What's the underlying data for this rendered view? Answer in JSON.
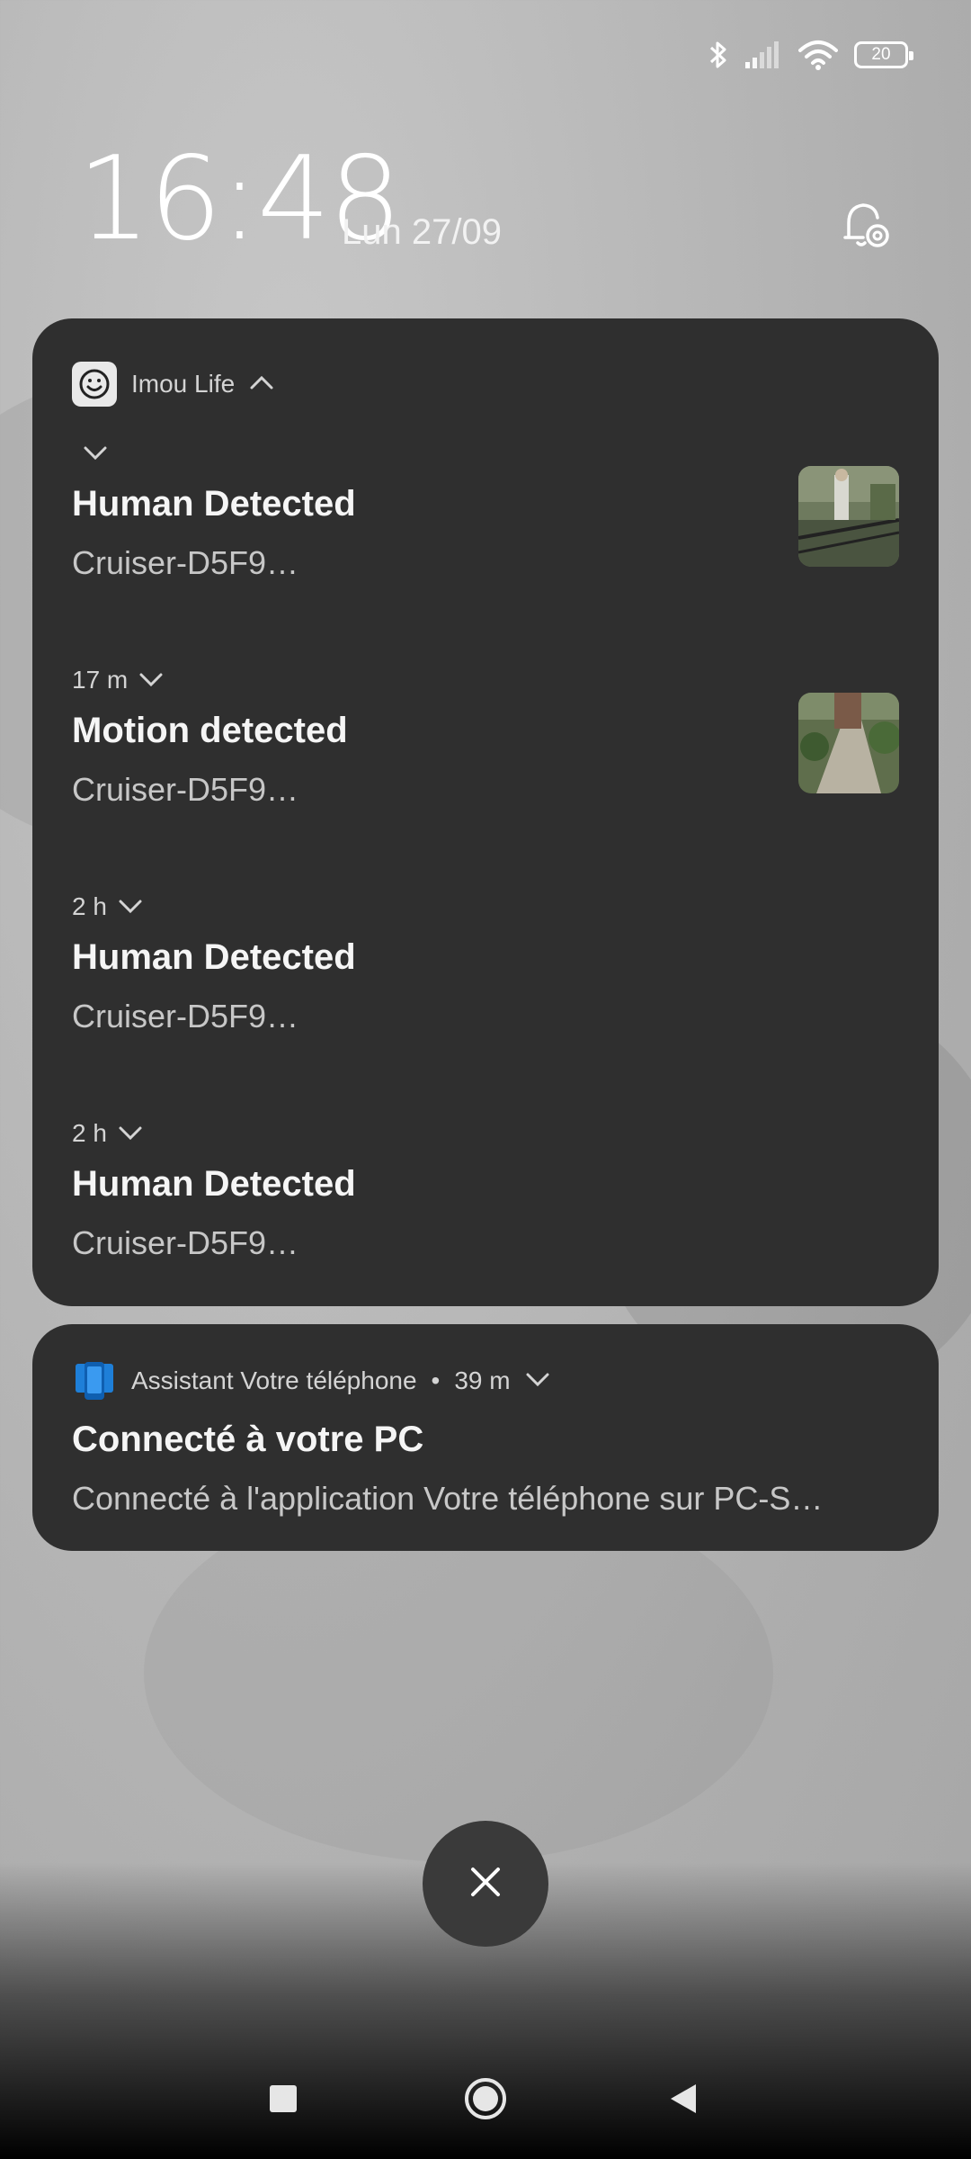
{
  "status_bar": {
    "battery_level": "20",
    "icons": [
      "bluetooth-icon",
      "signal-icon",
      "wifi-icon",
      "battery-icon"
    ]
  },
  "lockscreen": {
    "time": "16:48",
    "date": "Lun 27/09"
  },
  "group_notification": {
    "app_name": "Imou Life",
    "items": [
      {
        "meta": "",
        "title": "Human Detected",
        "body": "Cruiser-D5F9…",
        "has_thumbnail": true
      },
      {
        "meta": "17 m",
        "title": "Motion detected",
        "body": "Cruiser-D5F9…",
        "has_thumbnail": true
      },
      {
        "meta": "2 h",
        "title": "Human Detected",
        "body": "Cruiser-D5F9…",
        "has_thumbnail": false
      },
      {
        "meta": "2 h",
        "title": "Human Detected",
        "body": "Cruiser-D5F9…",
        "has_thumbnail": false
      }
    ]
  },
  "phone_notification": {
    "app_name": "Assistant Votre téléphone",
    "separator": "•",
    "time": "39 m",
    "title": "Connecté à votre PC",
    "body": "Connecté à l'application Votre téléphone sur PC-S…"
  },
  "colors": {
    "card_bg": "#2f2f2f",
    "accent_blue": "#1e7fd8"
  }
}
